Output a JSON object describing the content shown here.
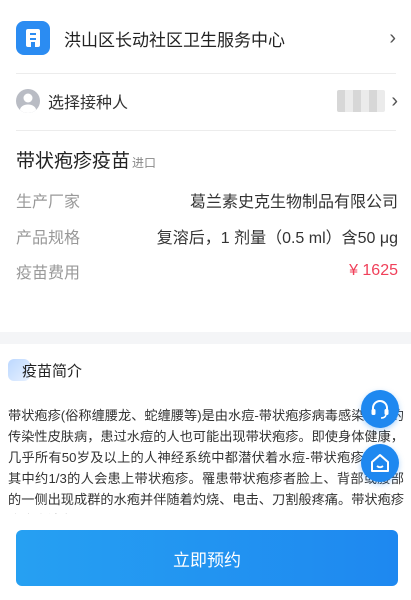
{
  "clinic": {
    "name": "洪山区长动社区卫生服务中心",
    "icon": "clinic-icon"
  },
  "person": {
    "label": "选择接种人",
    "icon": "user-avatar-icon"
  },
  "vaccine": {
    "title": "带状疱疹疫苗",
    "badge": "进口",
    "manufacturer_label": "生产厂家",
    "manufacturer_value": "葛兰素史克生物制品有限公司",
    "spec_label": "产品规格",
    "spec_value": "复溶后，1 剂量（0.5 ml）含50 μg",
    "fee_label": "疫苗费用",
    "fee_value": "¥ 1625"
  },
  "intro": {
    "title": "疫苗简介",
    "text": "带状疱疹(俗称缠腰龙、蛇缠腰等)是由水痘-带状疱疹病毒感染引起的传染性皮肤病，患过水痘的人也可能出现带状疱疹。即使身体健康，几乎所有50岁及以上的人神经系统中都潜伏着水痘-带状疱疹病毒，其中约1/3的人会患上带状疱疹。罹患带状疱疹者脸上、背部或腰部的一侧出现成群的水疱并伴随着灼烧、电击、刀割般疼痛。带状疱疹治疗方法有限，"
  },
  "floating": {
    "service_icon": "headset-icon",
    "home_icon": "home-icon"
  },
  "action": {
    "book_label": "立即预约"
  },
  "colors": {
    "accent": "#1e88f0",
    "price": "#f0405a"
  }
}
